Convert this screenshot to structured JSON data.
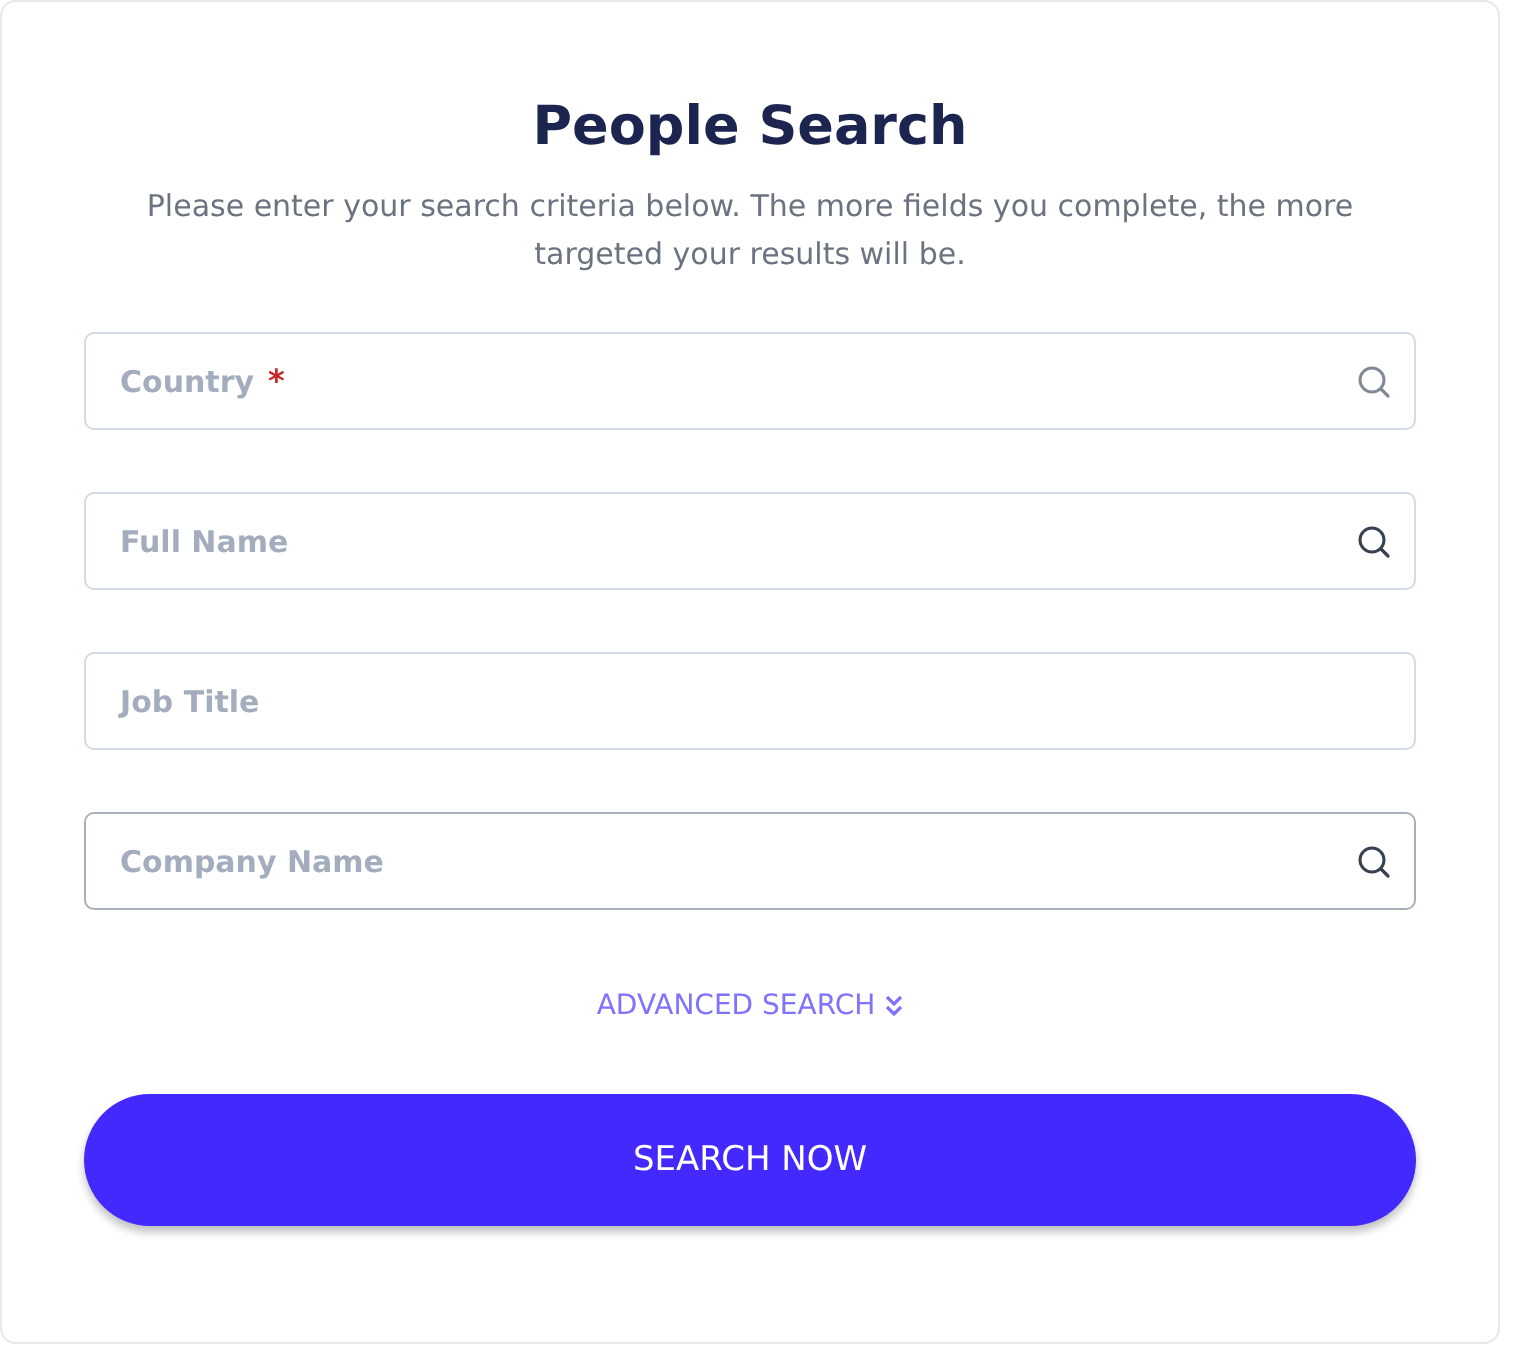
{
  "title": "People Search",
  "subtitle": "Please enter your search criteria below. The more fields you complete, the more targeted your results will be.",
  "fields": [
    {
      "placeholder": "Country",
      "required": true,
      "search_icon": true,
      "focused": false
    },
    {
      "placeholder": "Full Name",
      "required": false,
      "search_icon": true,
      "focused": false
    },
    {
      "placeholder": "Job Title",
      "required": false,
      "search_icon": false,
      "focused": false
    },
    {
      "placeholder": "Company Name",
      "required": false,
      "search_icon": true,
      "focused": true
    }
  ],
  "required_mark": "*",
  "advanced_link": "ADVANCED SEARCH",
  "submit_button": "SEARCH NOW"
}
